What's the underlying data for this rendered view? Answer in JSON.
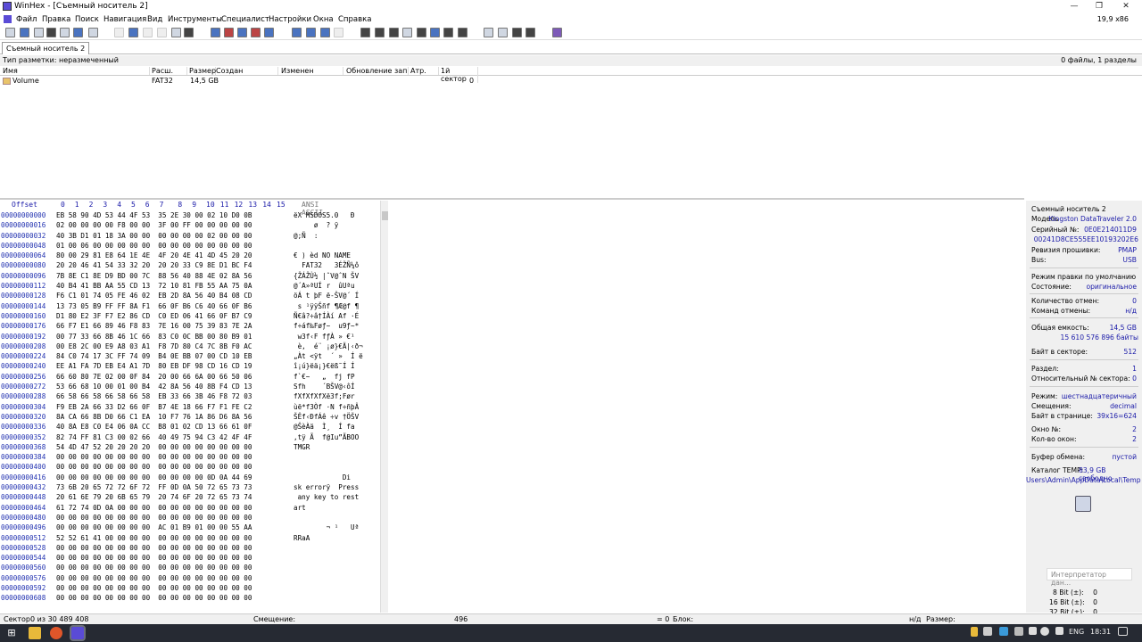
{
  "window": {
    "title": "WinHex - [Съемный носитель 2]",
    "version_label": "19,9 x86"
  },
  "menu": [
    "Файл",
    "Правка",
    "Поиск",
    "Навигация",
    "Вид",
    "Инструменты",
    "Специалист",
    "Настройки",
    "Окна",
    "Справка"
  ],
  "toolbar": {
    "icons": [
      "new-file-icon",
      "open-icon",
      "save-icon",
      "print-icon",
      "properties-icon",
      "copy-icon",
      "paste-icon",
      "undo-icon",
      "copy-block-icon",
      "clipboard-icon",
      "paste-icon",
      "write-icon",
      "fill-icon",
      "find-icon",
      "find-hex-icon",
      "replace-icon",
      "replace-hex-icon",
      "goto-offset-icon",
      "goto-sector-icon",
      "back-icon",
      "forward-icon",
      "open-disk-icon",
      "ram-icon",
      "disk-tools-icon",
      "snapshot-icon",
      "search-disk-icon",
      "wipe-icon",
      "analyze-icon",
      "template-icon",
      "grid-icon",
      "prev-icon",
      "next-icon",
      "help-icon"
    ]
  },
  "tab": {
    "label": "Съемный носитель 2"
  },
  "info": {
    "partition_type": "Тип разметки: неразмеченный",
    "summary": "0 файлы, 1 разделы"
  },
  "columns": [
    "Имя",
    "Расш.",
    "Размер",
    "Создан",
    "Изменен",
    "Обновление запис",
    "Атр.",
    "1й сектор"
  ],
  "files": [
    {
      "name": "Volume",
      "ext": "FAT32",
      "size": "14,5 GB",
      "first_sector": "0"
    }
  ],
  "hex": {
    "offset_label": "Offset",
    "col_labels": [
      "0",
      "1",
      "2",
      "3",
      "4",
      "5",
      "6",
      "7",
      "8",
      "9",
      "10",
      "11",
      "12",
      "13",
      "14",
      "15"
    ],
    "ascii_label": "ANSI ASCII",
    "rows": [
      {
        "off": "00000000000",
        "bytes": "EB 58 90 4D 53 44 4F 53  35 2E 30 00 02 10 D0 0B",
        "ascii": "ëX MSDOS5.0   Ð"
      },
      {
        "off": "00000000016",
        "bytes": "02 00 00 00 00 F8 00 00  3F 00 FF 00 00 00 00 00",
        "ascii": "     ø  ? ÿ"
      },
      {
        "off": "00000000032",
        "bytes": "40 3B D1 01 18 3A 00 00  00 00 00 00 02 00 00 00",
        "ascii": "@;Ñ  :"
      },
      {
        "off": "00000000048",
        "bytes": "01 00 06 00 00 00 00 00  00 00 00 00 00 00 00 00",
        "ascii": ""
      },
      {
        "off": "00000000064",
        "bytes": "80 00 29 81 E8 64 1E 4E  4F 20 4E 41 4D 45 20 20",
        "ascii": "€ ) èd NO NAME"
      },
      {
        "off": "00000000080",
        "bytes": "20 20 46 41 54 33 32 20  20 20 33 C9 8E D1 BC F4",
        "ascii": "  FAT32   3ÉŽÑ¼ô"
      },
      {
        "off": "00000000096",
        "bytes": "7B 8E C1 8E D9 BD 00 7C  88 56 40 88 4E 02 8A 56",
        "ascii": "{ŽÁŽÙ½ |ˆV@ˆN ŠV"
      },
      {
        "off": "00000000112",
        "bytes": "40 B4 41 BB AA 55 CD 13  72 10 81 FB 55 AA 75 0A",
        "ascii": "@´A»ªUÍ r  ûUªu"
      },
      {
        "off": "00000000128",
        "bytes": "F6 C1 01 74 05 FE 46 02  EB 2D 8A 56 40 B4 08 CD",
        "ascii": "öÁ t þF ë-ŠV@´ Í"
      },
      {
        "off": "00000000144",
        "bytes": "13 73 05 B9 FF FF 8A F1  66 0F B6 C6 40 66 0F B6",
        "ascii": " s ¹ÿÿŠñf ¶Æ@f ¶"
      },
      {
        "off": "00000000160",
        "bytes": "D1 80 E2 3F F7 E2 86 CD  C0 ED 06 41 66 0F B7 C9",
        "ascii": "Ñ€â?÷â†ÍÀí Af ·É"
      },
      {
        "off": "00000000176",
        "bytes": "66 F7 E1 66 89 46 F8 83  7E 16 00 75 39 83 7E 2A",
        "ascii": "f÷áf‰Føƒ~  u9ƒ~*"
      },
      {
        "off": "00000000192",
        "bytes": "00 77 33 66 8B 46 1C 66  83 C0 0C BB 00 80 B9 01",
        "ascii": " w3f‹F fƒÀ » €¹"
      },
      {
        "off": "00000000208",
        "bytes": "00 E8 2C 00 E9 A8 03 A1  F8 7D 80 C4 7C 8B F0 AC",
        "ascii": " è,  é¨ ¡ø}€Ä|‹ð¬"
      },
      {
        "off": "00000000224",
        "bytes": "84 C0 74 17 3C FF 74 09  B4 0E BB 07 00 CD 10 EB",
        "ascii": "„Àt <ÿt  ´ »  Í ë"
      },
      {
        "off": "00000000240",
        "bytes": "EE A1 FA 7D EB E4 A1 7D  80 EB DF 98 CD 16 CD 19",
        "ascii": "î¡ú}ëä¡}€ëß˜Í Í"
      },
      {
        "off": "00000000256",
        "bytes": "66 60 80 7E 02 00 0F 84  20 00 66 6A 00 66 50 06",
        "ascii": "f`€~   „  fj fP"
      },
      {
        "off": "00000000272",
        "bytes": "53 66 68 10 00 01 00 B4  42 8A 56 40 8B F4 CD 13",
        "ascii": "Sfh    ´BŠV@‹ôÍ"
      },
      {
        "off": "00000000288",
        "bytes": "66 58 66 58 66 58 66 58  EB 33 66 3B 46 F8 72 03",
        "ascii": "fXfXfXfXë3f;Før"
      },
      {
        "off": "00000000304",
        "bytes": "F9 EB 2A 66 33 D2 66 0F  B7 4E 18 66 F7 F1 FE C2",
        "ascii": "ùë*f3Òf ·N f÷ñþÂ"
      },
      {
        "off": "00000000320",
        "bytes": "8A CA 66 8B D0 66 C1 EA  10 F7 76 1A 86 D6 8A 56",
        "ascii": "ŠÊf‹ÐfÁê ÷v †ÖŠV"
      },
      {
        "off": "00000000336",
        "bytes": "40 8A E8 C0 E4 06 0A CC  B8 01 02 CD 13 66 61 0F",
        "ascii": "@ŠèÀä  Ì¸  Í fa"
      },
      {
        "off": "00000000352",
        "bytes": "82 74 FF 81 C3 00 02 66  40 49 75 94 C3 42 4F 4F",
        "ascii": "‚tÿ Ã  f@Iu”ÃBOO"
      },
      {
        "off": "00000000368",
        "bytes": "54 4D 47 52 20 20 20 20  00 00 00 00 00 00 00 00",
        "ascii": "TMGR"
      },
      {
        "off": "00000000384",
        "bytes": "00 00 00 00 00 00 00 00  00 00 00 00 00 00 00 00",
        "ascii": ""
      },
      {
        "off": "00000000400",
        "bytes": "00 00 00 00 00 00 00 00  00 00 00 00 00 00 00 00",
        "ascii": ""
      },
      {
        "off": "00000000416",
        "bytes": "00 00 00 00 00 00 00 00  00 00 00 00 0D 0A 44 69",
        "ascii": "            Di"
      },
      {
        "off": "00000000432",
        "bytes": "73 6B 20 65 72 72 6F 72  FF 0D 0A 50 72 65 73 73",
        "ascii": "sk errorÿ  Press"
      },
      {
        "off": "00000000448",
        "bytes": "20 61 6E 79 20 6B 65 79  20 74 6F 20 72 65 73 74",
        "ascii": " any key to rest"
      },
      {
        "off": "00000000464",
        "bytes": "61 72 74 0D 0A 00 00 00  00 00 00 00 00 00 00 00",
        "ascii": "art"
      },
      {
        "off": "00000000480",
        "bytes": "00 00 00 00 00 00 00 00  00 00 00 00 00 00 00 00",
        "ascii": ""
      },
      {
        "off": "00000000496",
        "bytes": "00 00 00 00 00 00 00 00  AC 01 B9 01 00 00 55 AA",
        "ascii": "        ¬ ¹   Uª"
      },
      {
        "off": "00000000512",
        "bytes": "52 52 61 41 00 00 00 00  00 00 00 00 00 00 00 00",
        "ascii": "RRaA"
      },
      {
        "off": "00000000528",
        "bytes": "00 00 00 00 00 00 00 00  00 00 00 00 00 00 00 00",
        "ascii": ""
      },
      {
        "off": "00000000544",
        "bytes": "00 00 00 00 00 00 00 00  00 00 00 00 00 00 00 00",
        "ascii": ""
      },
      {
        "off": "00000000560",
        "bytes": "00 00 00 00 00 00 00 00  00 00 00 00 00 00 00 00",
        "ascii": ""
      },
      {
        "off": "00000000576",
        "bytes": "00 00 00 00 00 00 00 00  00 00 00 00 00 00 00 00",
        "ascii": ""
      },
      {
        "off": "00000000592",
        "bytes": "00 00 00 00 00 00 00 00  00 00 00 00 00 00 00 00",
        "ascii": ""
      },
      {
        "off": "00000000608",
        "bytes": "00 00 00 00 00 00 00 00  00 00 00 00 00 00 00 00",
        "ascii": ""
      }
    ]
  },
  "panel": {
    "device": "Съемный носитель 2",
    "model_k": "Модель",
    "model_v": "Kingston DataTraveler 2.0",
    "serial_k": "Серийный №:",
    "serial_v": "0E0E214011D9",
    "serial2": "00241D8CE555EE10193202E6",
    "fw_k": "Ревизия прошивки:",
    "fw_v": "PMAP",
    "bus_k": "Bus:",
    "bus_v": "USB",
    "edit_mode": "Режим правки по умолчанию",
    "state_k": "Состояние:",
    "state_v": "оригинальное",
    "undo_k": "Количество отмен:",
    "undo_v": "0",
    "undone_k": "Команд отмены:",
    "undone_v": "н/д",
    "cap_k": "Общая емкость:",
    "cap_v": "14,5 GB",
    "cap_bytes": "15 610 576 896 байты",
    "bps_k": "Байт в секторе:",
    "bps_v": "512",
    "part_k": "Раздел:",
    "part_v": "1",
    "relsec_k": "Относительный № сектора:",
    "relsec_v": "0",
    "mode_k": "Режим:",
    "mode_v": "шестнадцатеричный",
    "offsets_k": "Смещения:",
    "offsets_v": "decimal",
    "bpp_k": "Байт в странице:",
    "bpp_v": "39x16=624",
    "win_k": "Окно №:",
    "win_v": "2",
    "wins_k": "Кол-во окон:",
    "wins_v": "2",
    "clip_k": "Буфер обмена:",
    "clip_v": "пустой",
    "temp_k": "Каталог TEMP:",
    "temp_v": "83,9 GB свободно",
    "temp_path": "Users\\Admin\\AppData\\Local\\Temp",
    "interp_label": "Интерпретатор дан...",
    "b8_k": "8 Bit (±):",
    "b8_v": "0",
    "b16_k": "16 Bit (±):",
    "b16_v": "0",
    "b32_k": "32 Bit (±):",
    "b32_v": "0"
  },
  "status": {
    "sector": "Сектор0 из 30 489 408",
    "offset_k": "Смещение:",
    "offset_v": "496",
    "eq": "= 0",
    "block": "Блок:",
    "na": "н/д",
    "size": "Размер:"
  },
  "taskbar": {
    "lang": "ENG",
    "time": "18:31"
  }
}
